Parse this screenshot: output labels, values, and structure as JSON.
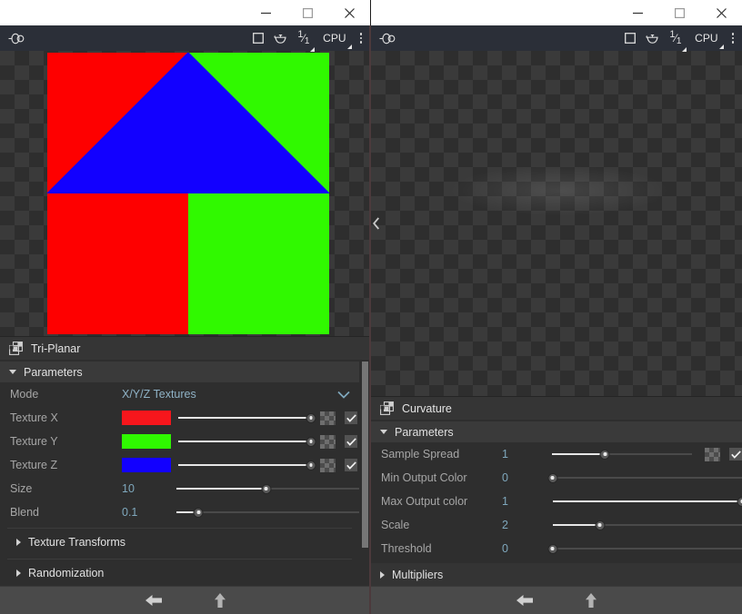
{
  "window": {
    "controls": [
      {
        "name": "minimize",
        "glyph": "minimize-icon"
      },
      {
        "name": "maximize",
        "glyph": "maximize-icon"
      },
      {
        "name": "close",
        "glyph": "close-icon"
      }
    ]
  },
  "panes": [
    {
      "id": "left",
      "viewport": {
        "toolbar": {
          "left_icon": "visibility-pin-icon",
          "square_icon": "square-outline-icon",
          "shape_icon": "teapot-icon",
          "zoom_ratio_numerator": "1",
          "zoom_ratio_denominator": "1",
          "engine_label": "CPU",
          "menu_icon": "more-vertical-icon"
        },
        "render": "tri-planar-cube-corner",
        "render_colors": {
          "top": "#1200ff",
          "left": "#fe0000",
          "right": "#30f900"
        }
      },
      "panel": {
        "title": "Tri-Planar",
        "icon": "node-layers-icon",
        "groups": [
          {
            "label": "Parameters",
            "expanded": true,
            "rows": [
              {
                "type": "dropdown",
                "label": "Mode",
                "value": "X/Y/Z Textures"
              },
              {
                "type": "color-slider",
                "label": "Texture X",
                "color": "#f7161c",
                "slider_pct": 100,
                "has_thumb": true,
                "checked": true
              },
              {
                "type": "color-slider",
                "label": "Texture Y",
                "color": "#2ff900",
                "slider_pct": 100,
                "has_thumb": true,
                "checked": true
              },
              {
                "type": "color-slider",
                "label": "Texture Z",
                "color": "#1200ff",
                "slider_pct": 100,
                "has_thumb": true,
                "checked": true
              },
              {
                "type": "value-slider",
                "label": "Size",
                "value": "10",
                "slider_pct": 49
              },
              {
                "type": "value-slider",
                "label": "Blend",
                "value": "0.1",
                "slider_pct": 12
              }
            ]
          },
          {
            "label": "Texture Transforms",
            "expanded": false,
            "rows": []
          },
          {
            "label": "Randomization",
            "expanded": false,
            "rows": []
          }
        ]
      },
      "bottombar": {
        "back_label": "back-arrow-icon",
        "up_label": "up-arrow-icon"
      }
    },
    {
      "id": "right",
      "viewport": {
        "toolbar": {
          "left_icon": "visibility-pin-icon",
          "square_icon": "square-outline-icon",
          "shape_icon": "teapot-icon",
          "zoom_ratio_numerator": "1",
          "zoom_ratio_denominator": "1",
          "engine_label": "CPU",
          "menu_icon": "more-vertical-icon"
        },
        "render": "curvature-grayscale",
        "render_colors": {
          "base": "#444444",
          "highlight": "#9a9a9a"
        }
      },
      "panel": {
        "title": "Curvature",
        "icon": "node-layers-icon",
        "groups": [
          {
            "label": "Parameters",
            "expanded": true,
            "rows": [
              {
                "type": "value-slider",
                "label": "Sample Spread",
                "value": "1",
                "slider_pct": 38,
                "short_track": true,
                "has_thumb": true,
                "checked": true
              },
              {
                "type": "value-slider",
                "label": "Min Output Color",
                "value": "0",
                "slider_pct": 0
              },
              {
                "type": "value-slider",
                "label": "Max Output color",
                "value": "1",
                "slider_pct": 100
              },
              {
                "type": "value-slider",
                "label": "Scale",
                "value": "2",
                "slider_pct": 25
              },
              {
                "type": "value-slider",
                "label": "Threshold",
                "value": "0",
                "slider_pct": 0
              }
            ]
          },
          {
            "label": "Multipliers",
            "expanded": false,
            "rows": []
          }
        ]
      },
      "bottombar": {
        "back_label": "back-arrow-icon",
        "up_label": "up-arrow-icon"
      }
    }
  ],
  "theme": {
    "panel_bg": "#2e2e2e",
    "group_bg": "#3a3a3a",
    "toolbar_bg": "#2b2f38",
    "bottombar_bg": "#4a4a4a",
    "label_color": "#a6a6a6",
    "value_color": "#7fa8bd",
    "divider_color": "#4c3a3c"
  }
}
